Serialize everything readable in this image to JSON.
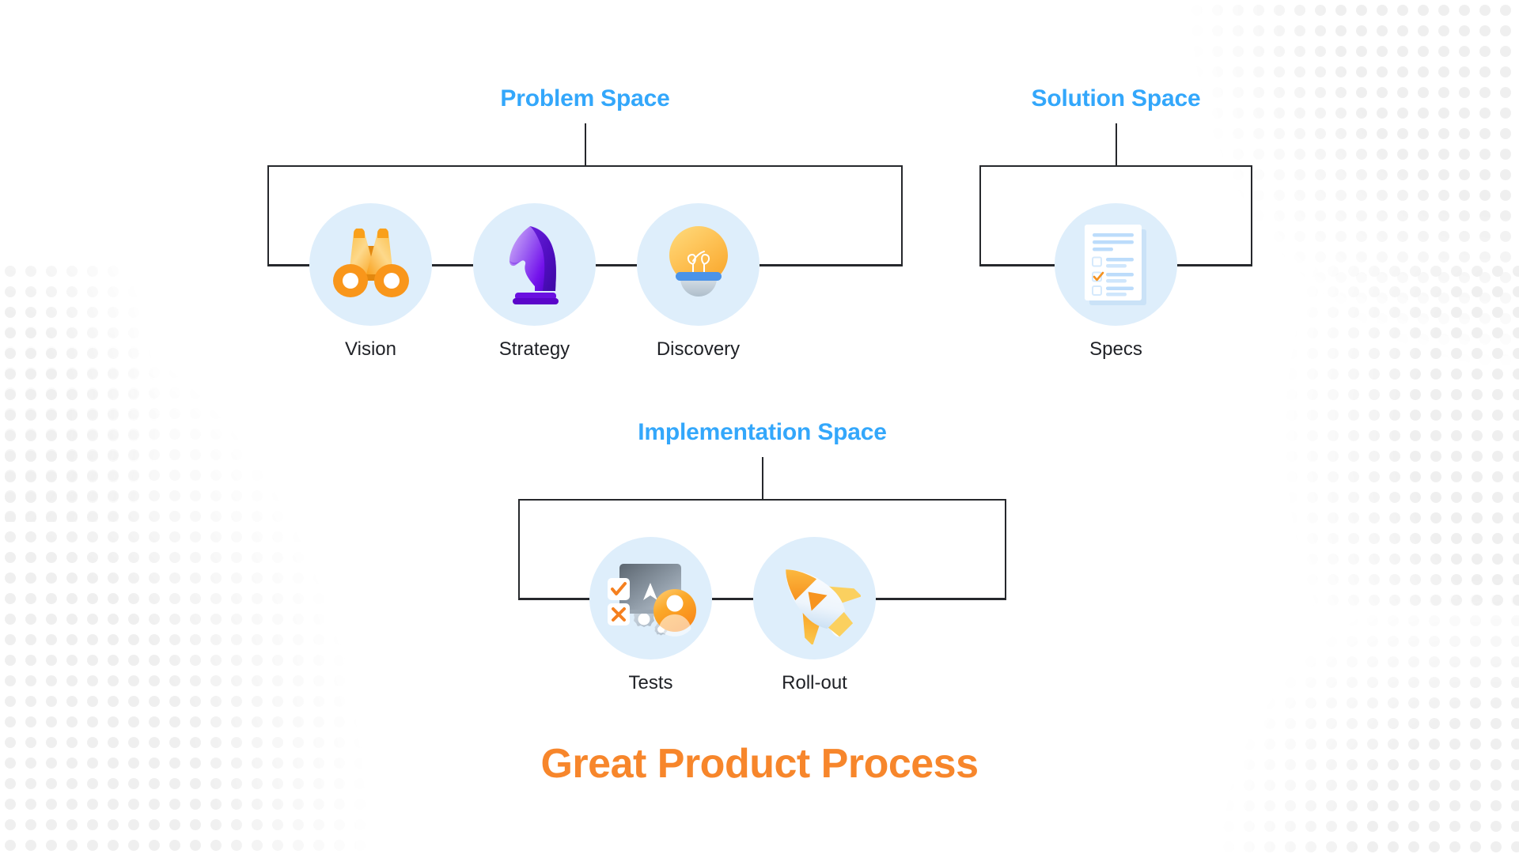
{
  "diagram": {
    "footer_title": "Great Product Process",
    "accent_blue": "#33A7FB",
    "accent_orange": "#F7862B",
    "bubble_color": "#DEEEFB",
    "line_color": "#26282C",
    "groups": [
      {
        "id": "problem-space",
        "title": "Problem Space",
        "nodes": [
          {
            "id": "vision",
            "label": "Vision",
            "icon": "binoculars-icon"
          },
          {
            "id": "strategy",
            "label": "Strategy",
            "icon": "chess-knight-icon"
          },
          {
            "id": "discovery",
            "label": "Discovery",
            "icon": "lightbulb-icon"
          }
        ]
      },
      {
        "id": "solution-space",
        "title": "Solution Space",
        "nodes": [
          {
            "id": "specs",
            "label": "Specs",
            "icon": "checklist-document-icon"
          }
        ]
      },
      {
        "id": "implementation-space",
        "title": "Implementation Space",
        "nodes": [
          {
            "id": "tests",
            "label": "Tests",
            "icon": "testing-screen-icon"
          },
          {
            "id": "roll-out",
            "label": "Roll-out",
            "icon": "rocket-icon"
          }
        ]
      }
    ]
  }
}
